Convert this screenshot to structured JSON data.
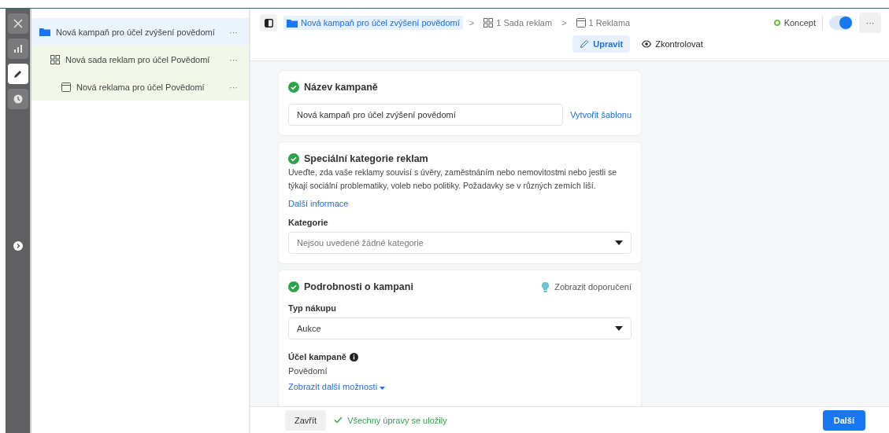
{
  "rail": {
    "items": [
      {
        "kind": "close",
        "selected": false
      },
      {
        "kind": "chart",
        "selected": false
      },
      {
        "kind": "edit",
        "selected": true
      },
      {
        "kind": "history",
        "selected": false
      }
    ]
  },
  "tree": [
    {
      "kind": "campaign",
      "label": "Nová kampaň pro účel zvýšení povědomí",
      "more": "···",
      "selected": true,
      "children": [
        {
          "kind": "adset",
          "label": "Nová sada reklam pro účel Povědomí",
          "more": "···",
          "selected": false,
          "children": [
            {
              "kind": "ad",
              "label": "Nová reklama pro účel Povědomí",
              "more": "···",
              "selected": false
            }
          ]
        }
      ]
    }
  ],
  "breadcrumbs": [
    {
      "kind": "campaign",
      "label": "Nová kampaň pro účel zvýšení povědomí",
      "selected": true
    },
    {
      "kind": "adset",
      "label": "1 Sada reklam",
      "selected": false
    },
    {
      "kind": "ad",
      "label": "1 Reklama",
      "selected": false
    }
  ],
  "separator": ">",
  "status": {
    "label": "Koncept",
    "color": "#6abf3b"
  },
  "toggle": {
    "on": true
  },
  "more": "···",
  "tabs": [
    {
      "kind": "edit",
      "label": "Upravit",
      "selected": true
    },
    {
      "kind": "review",
      "label": "Zkontrolovat",
      "selected": false
    }
  ],
  "name_card": {
    "title": "Název kampaně",
    "done": true,
    "value": "Nová kampaň pro účel zvýšení povědomí",
    "link": "Vytvořit šablonu"
  },
  "special_card": {
    "title": "Speciální kategorie reklam",
    "done": true,
    "description": "Uveďte, zda vaše reklamy souvisí s úvěry, zaměstnáním nebo nemovitostmi nebo jestli se týkají sociální problematiky, voleb nebo politiky. Požadavky se v různých zemích liší.",
    "link": "Další informace",
    "field_label": "Kategorie",
    "placeholder": "Nejsou uvedené žádné kategorie"
  },
  "details_card": {
    "title": "Podrobnosti o kampani",
    "done": true,
    "tip": "Zobrazit doporučení",
    "buy_label": "Typ nákupu",
    "buy_value": "Aukce",
    "goal_label": "Účel kampaně",
    "goal_value": "Povědomí",
    "more_link": "Zobrazit další možnosti"
  },
  "footer": {
    "close": "Zavřít",
    "saved": "Všechny úpravy se uložily",
    "next": "Další"
  }
}
